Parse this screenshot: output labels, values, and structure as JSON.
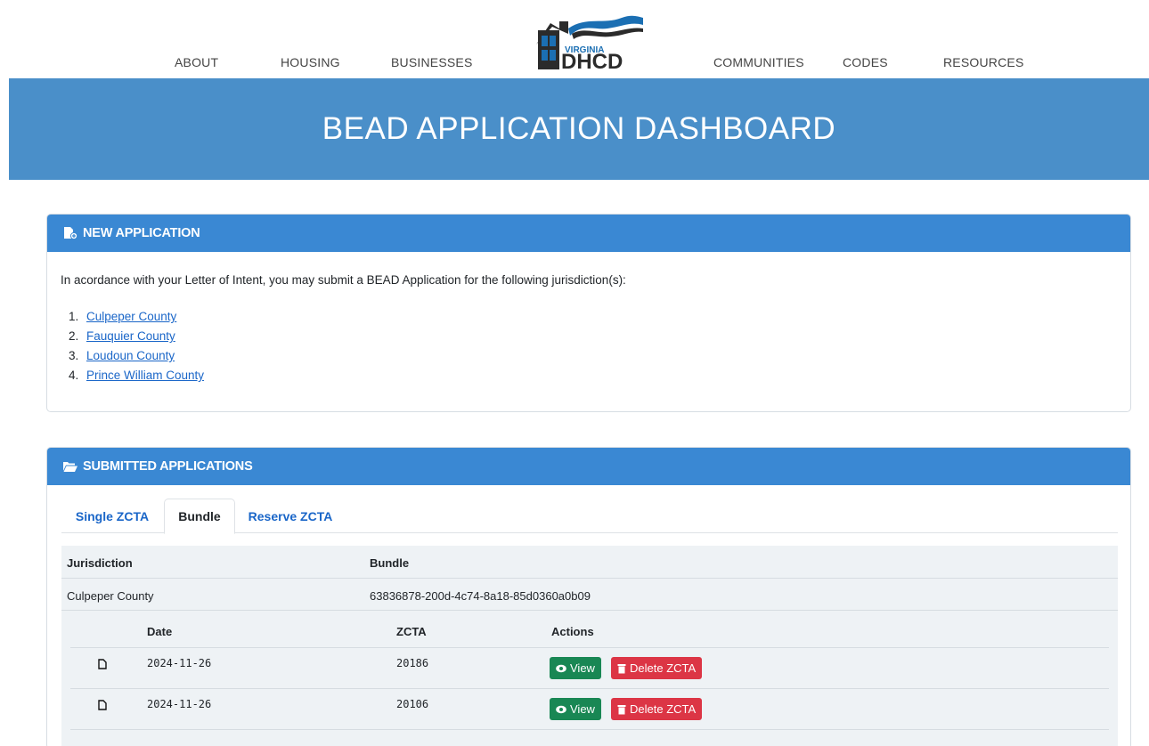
{
  "nav": {
    "items_left": [
      "ABOUT",
      "HOUSING",
      "BUSINESSES"
    ],
    "items_right": [
      "COMMUNITIES",
      "CODES",
      "RESOURCES"
    ],
    "logo": {
      "line1": "VIRGINIA",
      "line2": "DHCD"
    }
  },
  "hero": {
    "title": "BEAD APPLICATION DASHBOARD"
  },
  "new_application": {
    "header": "NEW APPLICATION",
    "icon": "file-plus-icon",
    "intro": "In acordance with your Letter of Intent, you may submit a BEAD Application for the following jurisdiction(s):",
    "jurisdictions": [
      {
        "num": "1.",
        "name": "Culpeper County"
      },
      {
        "num": "2.",
        "name": "Fauquier County"
      },
      {
        "num": "3.",
        "name": "Loudoun County"
      },
      {
        "num": "4.",
        "name": "Prince William County"
      }
    ]
  },
  "submitted": {
    "header": "SUBMITTED APPLICATIONS",
    "icon": "folder-open-icon",
    "tabs": [
      "Single ZCTA",
      "Bundle",
      "Reserve ZCTA"
    ],
    "active_tab": "Bundle",
    "columns": [
      "Jurisdiction",
      "Bundle"
    ],
    "row": {
      "jurisdiction": "Culpeper County",
      "bundle": "63836878-200d-4c74-8a18-85d0360a0b09"
    },
    "sub_columns": [
      "Date",
      "ZCTA",
      "Actions"
    ],
    "sub_rows": [
      {
        "date": "2024-11-26",
        "zcta": "20186"
      },
      {
        "date": "2024-11-26",
        "zcta": "20106"
      }
    ],
    "view_label": "View",
    "delete_label": "Delete ZCTA"
  },
  "colors": {
    "hero": "#4a8fc9",
    "card_header": "#3a88d3",
    "link": "#1a66c8",
    "view": "#198754",
    "delete": "#dc3545"
  }
}
